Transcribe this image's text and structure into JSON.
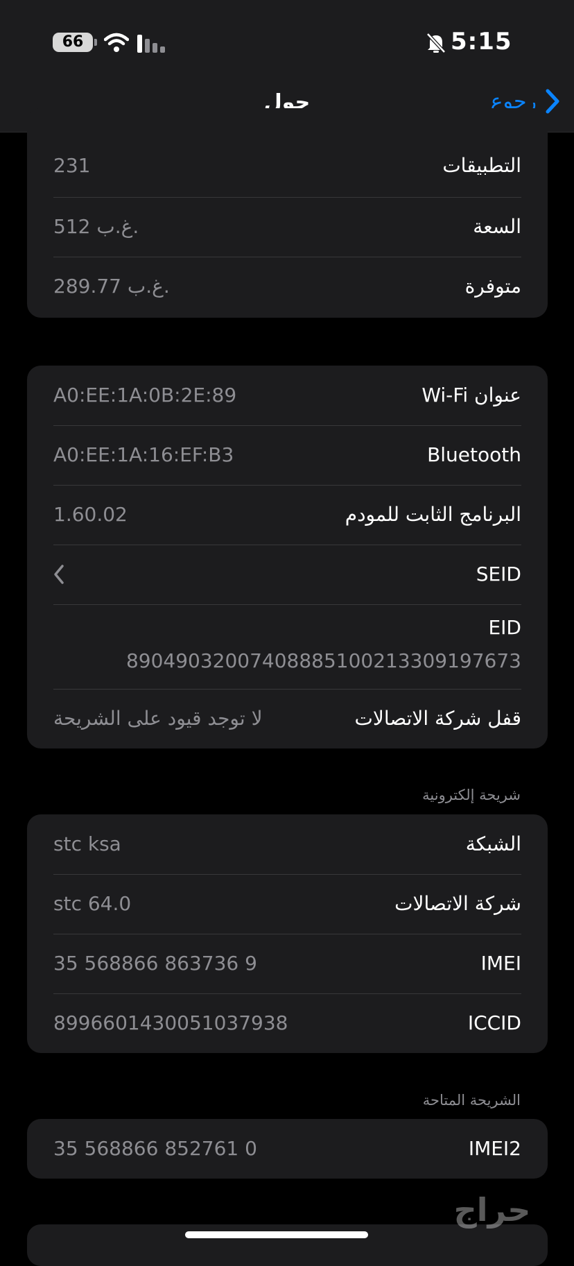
{
  "status_bar": {
    "battery": "66",
    "time": "5:15",
    "icons": [
      "battery-icon",
      "wifi-icon",
      "signal-icon",
      "bell-slash-icon"
    ]
  },
  "nav": {
    "title": "حول",
    "back_label": "رجوع",
    "icon": "chevron-right-icon"
  },
  "storage_rows": [
    {
      "label": "التطبيقات",
      "value": "231"
    },
    {
      "label": "السعة",
      "value": "512 غ.ب."
    },
    {
      "label": "متوفرة",
      "value": "289.77 غ.ب."
    }
  ],
  "network_rows": {
    "wifi": {
      "label": "عنوان Wi-Fi",
      "value": "A0:EE:1A:0B:2E:89"
    },
    "bluetooth": {
      "label": "Bluetooth",
      "value": "A0:EE:1A:16:EF:B3"
    },
    "modem": {
      "label": "البرنامج الثابت للمودم",
      "value": "1.60.02"
    },
    "seid": {
      "label": "SEID",
      "icon": "chevron-left-icon"
    },
    "eid": {
      "label": "EID",
      "value": "89049032007408885100213309197673"
    },
    "carrier_lock": {
      "label": "قفل شركة الاتصالات",
      "value": "لا توجد قيود على الشريحة"
    }
  },
  "esim_section": {
    "header": "شريحة إلكترونية",
    "rows": [
      {
        "label": "الشبكة",
        "value": "stc ksa"
      },
      {
        "label": "شركة الاتصالات",
        "value": "stc 64.0"
      },
      {
        "label": "IMEI",
        "value": "35 568866 863736 9"
      },
      {
        "label": "ICCID",
        "value": "8996601430051037938"
      }
    ]
  },
  "available_sim_section": {
    "header": "الشريحة المتاحة",
    "rows": [
      {
        "label": "IMEI2",
        "value": "35 568866 852761 0"
      }
    ]
  },
  "watermark": {
    "icon": "haraj-logo-icon",
    "text": "حراج"
  },
  "colors": {
    "background": "#000000",
    "card": "#1c1c1e",
    "accent": "#0a84ff",
    "secondary_text": "#8e8e93",
    "separator": "#38383a"
  }
}
